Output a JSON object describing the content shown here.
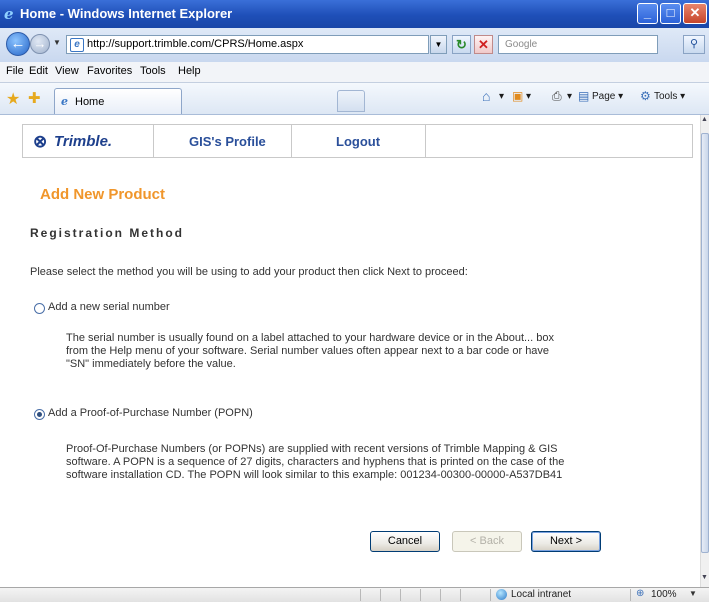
{
  "window": {
    "title": "Home - Windows Internet Explorer"
  },
  "address_bar": {
    "url": "http://support.trimble.com/CPRS/Home.aspx",
    "search_placeholder": "Google"
  },
  "menu": {
    "items": [
      "File",
      "Edit",
      "View",
      "Favorites",
      "Tools",
      "Help"
    ]
  },
  "tabs": {
    "active_label": "Home"
  },
  "command_bar": {
    "page_label": "Page",
    "tools_label": "Tools"
  },
  "site_nav": {
    "logo_text": "Trimble.",
    "profile_link": "GIS's Profile",
    "logout_link": "Logout"
  },
  "page": {
    "heading": "Add New Product",
    "section_heading": "Registration Method",
    "instructions": "Please select the method you will be using to add your product then click Next to proceed:",
    "options": [
      {
        "label": "Add a new serial number",
        "selected": false,
        "description": [
          "The serial number is usually found on a label attached to your hardware device or in the About... box",
          "from the Help menu of your software.  Serial number values often appear next to a bar code or have",
          "\"SN\" immediately before the value."
        ]
      },
      {
        "label": "Add a Proof-of-Purchase Number (POPN)",
        "selected": true,
        "description": [
          "Proof-Of-Purchase Numbers (or POPNs) are supplied with recent versions of Trimble Mapping & GIS",
          "software. A POPN is a sequence of 27 digits, characters and hyphens that is printed on the case of the",
          "software installation CD. The POPN will look similar to this example: 001234-00300-00000-A537DB41"
        ]
      }
    ],
    "buttons": {
      "cancel": "Cancel",
      "back": "< Back",
      "next": "Next >"
    }
  },
  "status_bar": {
    "zone": "Local intranet",
    "zoom": "100%"
  }
}
